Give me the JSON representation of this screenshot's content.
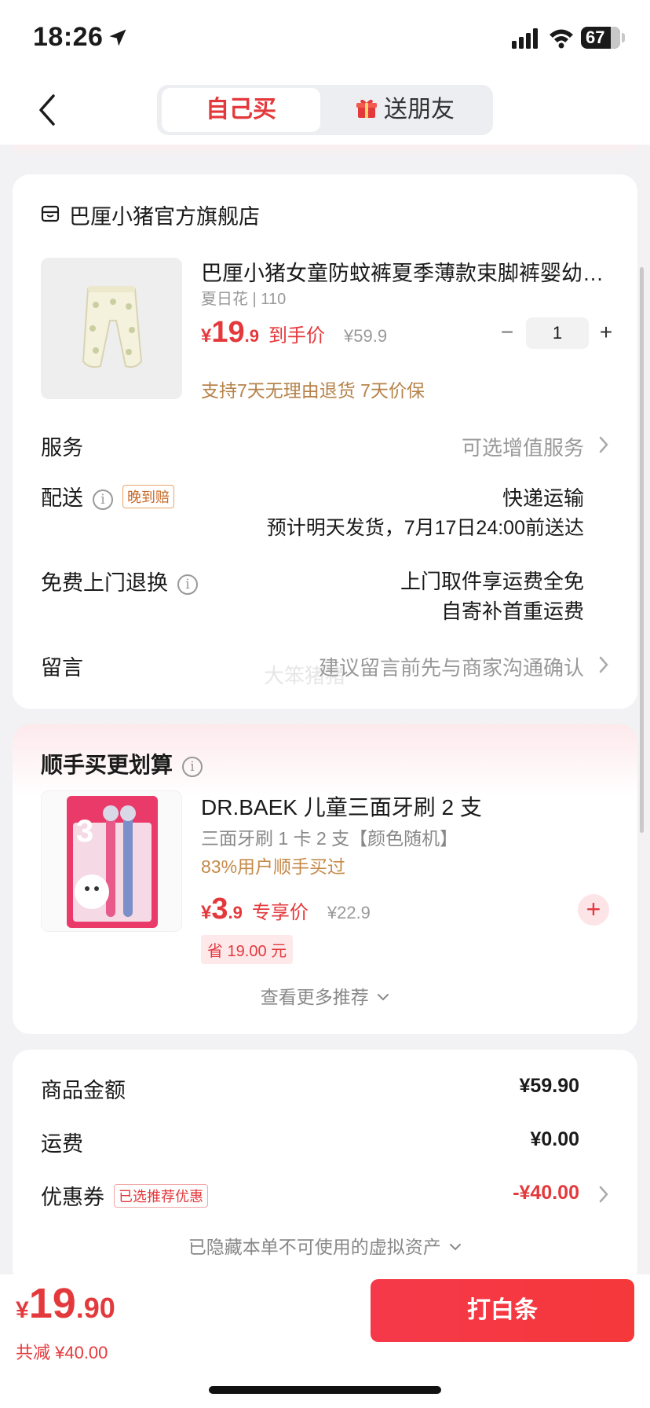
{
  "status": {
    "time": "18:26",
    "battery": "67"
  },
  "nav": {
    "tab_self": "自己买",
    "tab_gift": "送朋友"
  },
  "shop": {
    "name": "巴厘小猪官方旗舰店"
  },
  "product": {
    "title": "巴厘小猪女童防蚊裤夏季薄款束脚裤婴幼…",
    "spec": "夏日花 | 110",
    "price_symbol": "¥",
    "price_int": "19",
    "price_dec": ".9",
    "price_tag": "到手价",
    "price_old": "¥59.9",
    "qty": "1",
    "minus": "−",
    "plus": "+",
    "guarantee": "支持7天无理由退货   7天价保"
  },
  "service": {
    "label": "服务",
    "value": "可选增值服务"
  },
  "delivery": {
    "label": "配送",
    "badge": "晚到赔",
    "method": "快递运输",
    "eta": "预计明天发货，7月17日24:00前送达"
  },
  "return": {
    "label": "免费上门退换",
    "line1": "上门取件享运费全免",
    "line2": "自寄补首重运费"
  },
  "message": {
    "label": "留言",
    "placeholder": "建议留言前先与商家沟通确认"
  },
  "watermark": "大笨猪猪",
  "bundle": {
    "title": "顺手买更划算",
    "name": "DR.BAEK 儿童三面牙刷 2 支",
    "spec": "三面牙刷 1 卡 2 支【颜色随机】",
    "buy_rate": "83%用户顺手买过",
    "price_symbol": "¥",
    "price_int": "3",
    "price_dec": ".9",
    "price_tag": "专享价",
    "price_old": "¥22.9",
    "save": "省 19.00 元",
    "add": "+",
    "more": "查看更多推荐"
  },
  "summary": {
    "goods_label": "商品金额",
    "goods_value": "¥59.90",
    "freight_label": "运费",
    "freight_value": "¥0.00",
    "coupon_label": "优惠券",
    "coupon_badge": "已选推荐优惠",
    "coupon_value": "-¥40.00",
    "hidden_assets": "已隐藏本单不可使用的虚拟资产"
  },
  "footer": {
    "total_symbol": "¥",
    "total_int": "19",
    "total_dec": ".90",
    "reduced": "共减 ¥40.00",
    "pay_button": "打白条"
  },
  "colors": {
    "accent": "#e4393c",
    "gold": "#b6834a"
  },
  "icons": [
    "location-arrow-icon",
    "signal-icon",
    "wifi-icon",
    "battery-icon",
    "back-icon",
    "gift-icon",
    "shop-icon",
    "info-icon",
    "chevron-right-icon",
    "chevron-down-icon",
    "plus-icon"
  ]
}
